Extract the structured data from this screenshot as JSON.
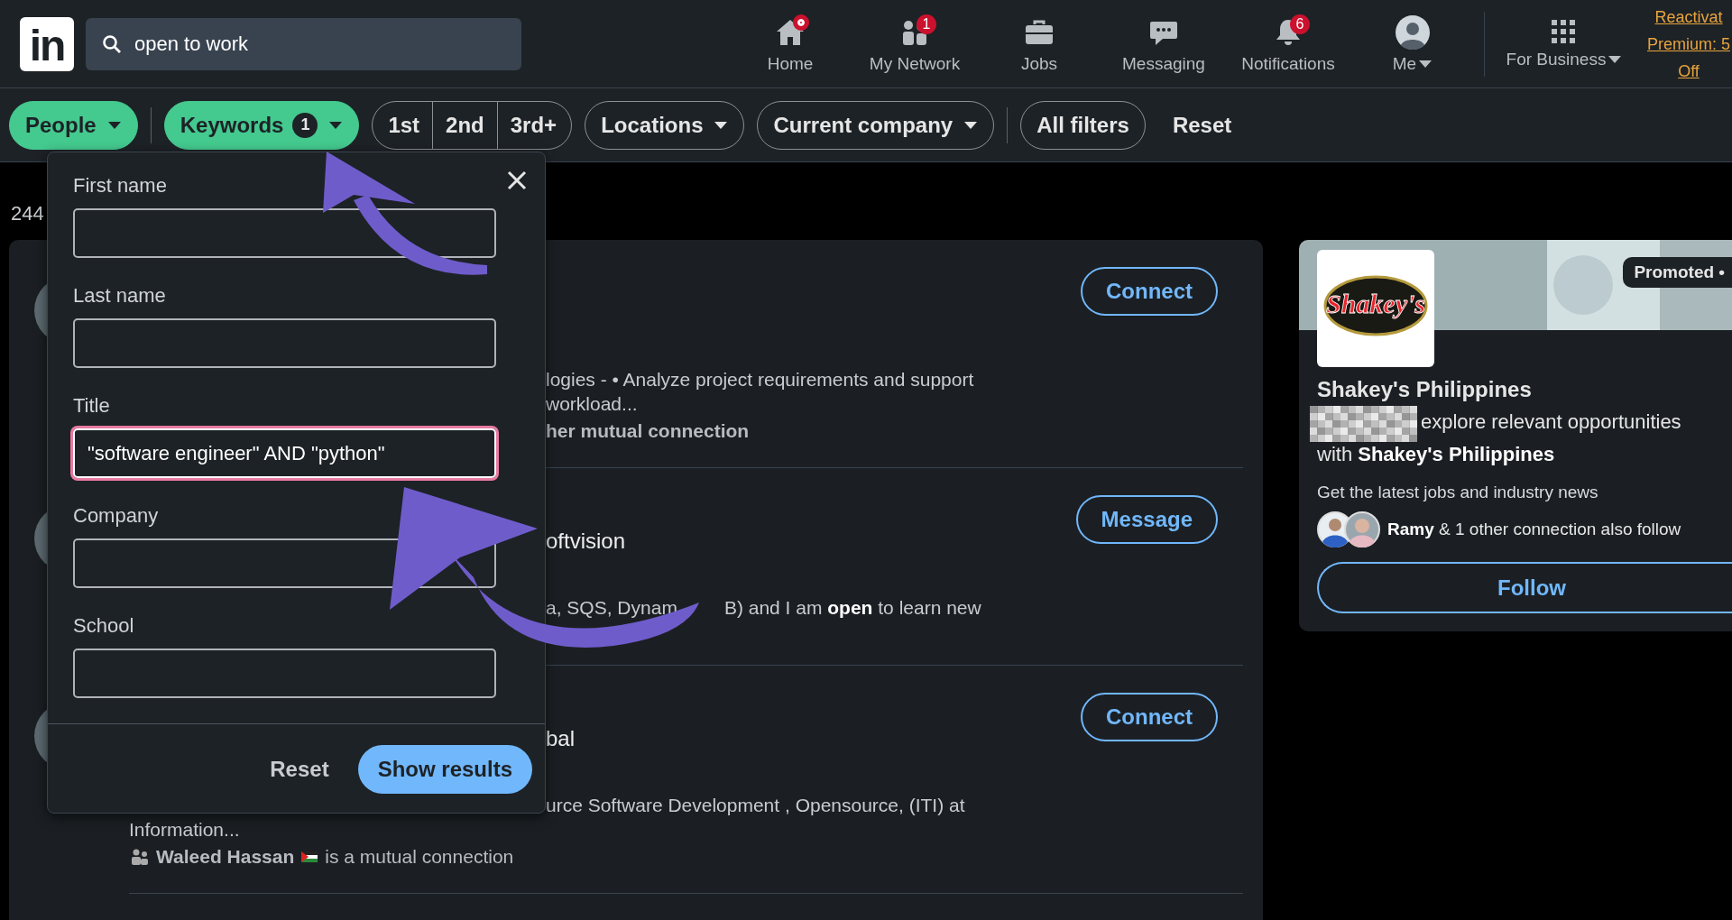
{
  "top_nav": {
    "logo": "in",
    "search": {
      "value": "open to work"
    },
    "items": [
      {
        "kind": "home",
        "label": "Home",
        "badge_dot": true
      },
      {
        "kind": "network",
        "label": "My Network",
        "badge": "1"
      },
      {
        "kind": "jobs",
        "label": "Jobs"
      },
      {
        "kind": "messaging",
        "label": "Messaging"
      },
      {
        "kind": "bell",
        "label": "Notifications",
        "badge": "6"
      },
      {
        "kind": "avatar",
        "label": "Me",
        "caret": true
      }
    ],
    "business": {
      "label": "For Business",
      "caret": true
    },
    "premium_link": [
      "Reactivat",
      "Premium: 5",
      "Off"
    ]
  },
  "filters": [
    {
      "kind": "pill",
      "label": "People",
      "caret": true,
      "selected": true
    },
    {
      "kind": "divider"
    },
    {
      "kind": "pill",
      "label": "Keywords",
      "count": "1",
      "caret": true,
      "selected": true
    },
    {
      "kind": "segments",
      "options": [
        {
          "label": "1st",
          "selected": false
        },
        {
          "label": "2nd",
          "selected": false
        },
        {
          "label": "3rd+",
          "selected": false
        }
      ]
    },
    {
      "kind": "pill",
      "label": "Locations",
      "caret": true,
      "selected": false
    },
    {
      "kind": "pill",
      "label": "Current company",
      "caret": true,
      "selected": false
    },
    {
      "kind": "divider"
    },
    {
      "kind": "pill",
      "label": "All filters",
      "caret": false,
      "selected": false
    },
    {
      "kind": "text",
      "label": "Reset"
    }
  ],
  "results_count": "244",
  "results": [
    {
      "action": "Connect",
      "lines": [
        {
          "kind": "snippet-fragment",
          "text": "logies - • Analyze project requirements and support"
        },
        {
          "kind": "snippet-fragment",
          "text": "workload..."
        },
        {
          "kind": "mutual-fragment",
          "text": "her mutual connection"
        }
      ]
    },
    {
      "action": "Message",
      "lines": [
        {
          "kind": "title-fragment",
          "text": "oftvision"
        },
        {
          "kind": "snippet-fragment",
          "text": "a, SQS, Dynam",
          "after": "B) and I am **open** to learn new"
        }
      ]
    },
    {
      "action": "Connect",
      "lines": [
        {
          "kind": "title-fragment",
          "text": "bal"
        },
        {
          "kind": "snippet-fragment",
          "text": "urce Software Development , Opensource, (ITI) at"
        },
        {
          "kind": "snippet",
          "text": "Information..."
        },
        {
          "kind": "mutual",
          "name": "Waleed Hassan",
          "text": "is a mutual connection",
          "flag": true
        }
      ]
    }
  ],
  "keyword_panel": {
    "fields": [
      {
        "label": "First name",
        "focused": false
      },
      {
        "label": "Last name",
        "focused": false
      },
      {
        "label": "Title",
        "value": "\"software engineer\" AND \"python\"",
        "focused": true
      },
      {
        "label": "Company",
        "focused": false
      },
      {
        "label": "School",
        "focused": false
      }
    ],
    "reset": "Reset",
    "submit": "Show results"
  },
  "ad": {
    "badge": "Promoted •",
    "logo_text": "Shakey's",
    "company": "Shakey's Philippines",
    "pitch": [
      "explore relevant opportunities",
      "with **Shakey's Philippines**"
    ],
    "tagline": "Get the latest jobs and industry news",
    "followers": "**Ramy** & 1 other connection also follow",
    "button": "Follow"
  }
}
